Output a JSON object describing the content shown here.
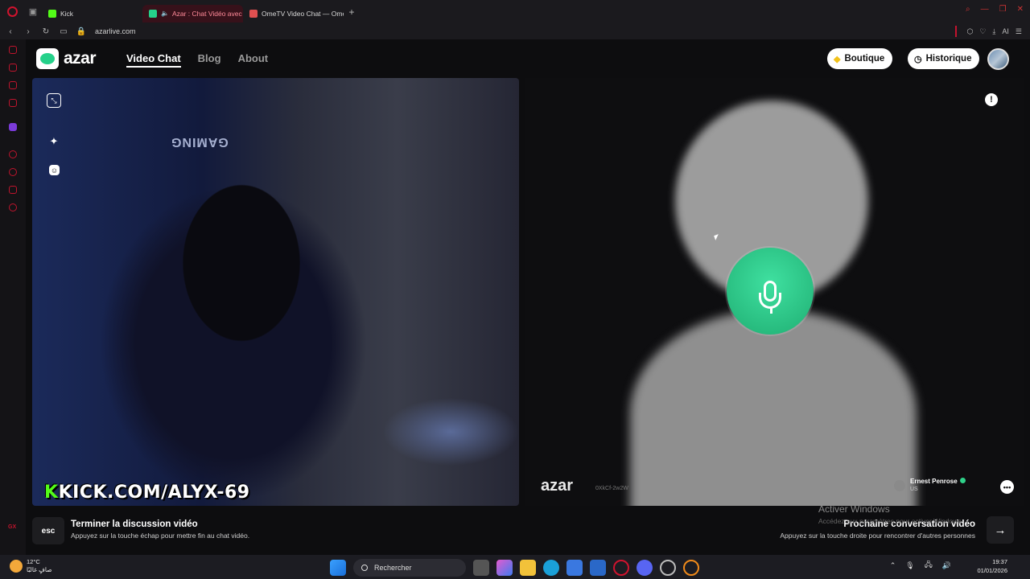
{
  "browser": {
    "tabs": [
      {
        "label": "Kick",
        "favicon_color": "#53fc18",
        "active": false
      },
      {
        "label": "Azar : Chat Vidéo avec",
        "favicon_color": "#25d18a",
        "active": true
      },
      {
        "label": "OmeTV Video Chat — Ome",
        "favicon_color": "#e05050",
        "active": false
      }
    ],
    "new_tab": "+",
    "url": "azarlive.com",
    "ai_label": "AI"
  },
  "header": {
    "logo_text": "azar",
    "nav": [
      "Video Chat",
      "Blog",
      "About"
    ],
    "boutique_label": "Boutique",
    "historique_label": "Historique"
  },
  "left_video": {
    "chair_text": "GAMING",
    "kick_overlay": "KICK.COM/ALYX-69",
    "kick_prefix": "K"
  },
  "right_video": {
    "watermark": "azar",
    "watermark_id": "0XkCf-2w2W",
    "partner_name": "Ernest Penrose",
    "partner_country": "US",
    "report_symbol": "!",
    "chat_symbol": "•••"
  },
  "footer": {
    "esc_label": "esc",
    "end_title": "Terminer la discussion vidéo",
    "end_sub": "Appuyez sur la touche échap pour mettre fin au chat vidéo.",
    "next_title": "Prochaine conversation vidéo",
    "next_sub": "Appuyez sur la touche droite pour rencontrer d'autres personnes",
    "next_arrow": "→"
  },
  "windows_watermark": {
    "title": "Activer Windows",
    "sub": "Accédez aux paramètres pour activer Windows."
  },
  "taskbar": {
    "temperature": "12°C",
    "weather_desc": "صافٍ غالبًا",
    "search_placeholder": "Rechercher",
    "time": "19:37",
    "date": "01/01/2026"
  },
  "colors": {
    "accent_green": "#25d18a",
    "opera_red": "#d0132e"
  }
}
